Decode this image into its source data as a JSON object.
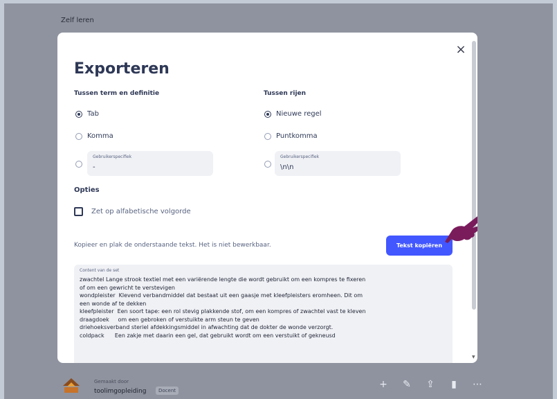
{
  "background": {
    "title": "Zelf leren",
    "footer": {
      "meta": "Gemaakt door",
      "user": "toolimgopleiding",
      "badge": "Docent",
      "actions": [
        "add-icon",
        "edit-icon",
        "share-icon",
        "stats-icon",
        "more-icon"
      ]
    }
  },
  "modal": {
    "title": "Exporteren",
    "close_label": "×",
    "left_column": {
      "heading": "Tussen term en definitie",
      "options": [
        "Tab",
        "Komma"
      ],
      "selected": "Tab",
      "custom": {
        "label": "Gebruikerspecifiek",
        "value": "-"
      }
    },
    "right_column": {
      "heading": "Tussen rijen",
      "options": [
        "Nieuwe regel",
        "Puntkomma"
      ],
      "selected": "Nieuwe regel",
      "custom": {
        "label": "Gebruikerspecifiek",
        "value": "\\n\\n"
      }
    },
    "options": {
      "heading": "Opties",
      "alphabetical_label": "Zet op alfabetische volgorde",
      "alphabetical_checked": false
    },
    "copy": {
      "hint": "Kopieer en plak de onderstaande tekst. Het is niet bewerkbaar.",
      "button": "Tekst kopiëren"
    },
    "export_text": {
      "label": "Content van de set",
      "content": "zwachtel Lange strook textiel met een variërende lengte die wordt gebruikt om een kompres te fixeren\nof om een gewricht te verstevigen\nwondpleister  Klevend verbandmiddel dat bestaat uit een gaasje met kleefpleisters eromheen. Dit om\neen wonde af te dekken\nkleefpleister  Een soort tape: een rol stevig plakkende stof, om een kompres of zwachtel vast te kleven\ndraagdoek     om een gebroken of verstuikte arm steun te geven\ndriehoeksverband steriel afdekkingsmiddel in afwachting dat de dokter de wonde verzorgt.\ncoldpack      Een zakje met daarin een gel, dat gebruikt wordt om een verstuikt of gekneusd"
    }
  },
  "colors": {
    "accent": "#4257ff",
    "pointer": "#7a1c5c",
    "text_dark": "#2e3856"
  }
}
